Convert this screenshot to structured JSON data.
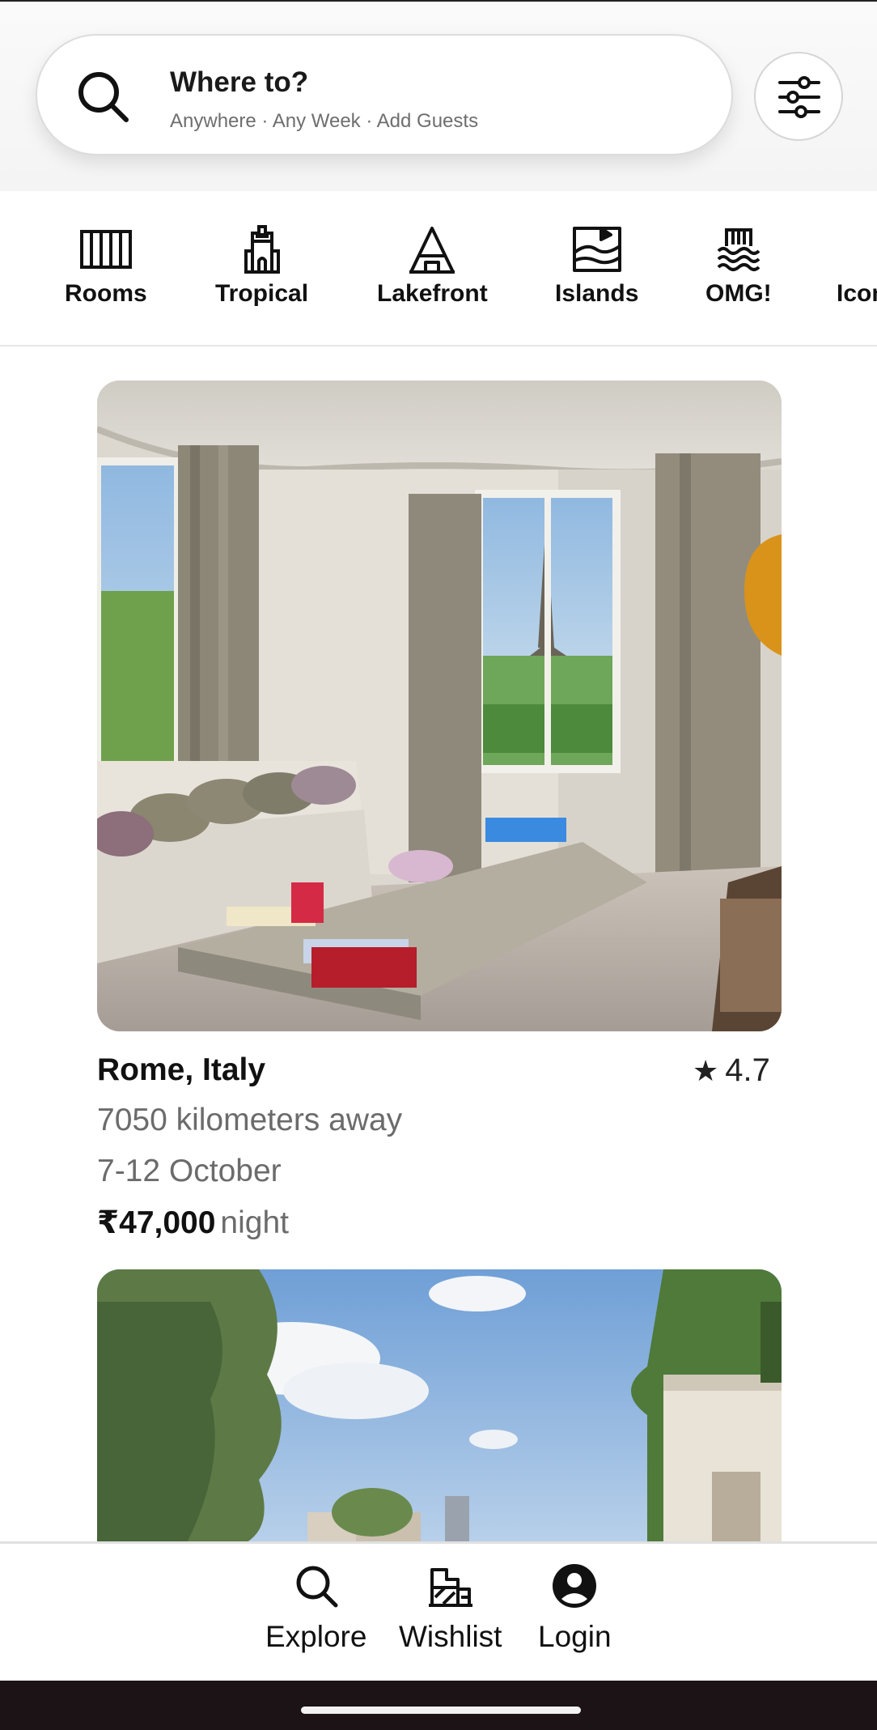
{
  "search": {
    "title": "Where to?",
    "subtitle": "Anywhere · Any Week · Add Guests",
    "icon": "search-icon"
  },
  "filter": {
    "icon": "sliders-icon"
  },
  "categories": [
    {
      "label": "Rooms",
      "icon": "rooms-icon"
    },
    {
      "label": "Tropical",
      "icon": "tower-icon"
    },
    {
      "label": "Lakefront",
      "icon": "a-frame-icon"
    },
    {
      "label": "Islands",
      "icon": "island-map-icon"
    },
    {
      "label": "OMG!",
      "icon": "waves-icon"
    },
    {
      "label": "Icons",
      "icon": "icons-icon"
    }
  ],
  "listing": {
    "title": "Rome, Italy",
    "rating_star": "★",
    "rating": "4.7",
    "distance": "7050 kilometers away",
    "dates": "7-12 October",
    "price": "₹47,000",
    "price_unit": "night"
  },
  "nav": [
    {
      "label": "Explore",
      "icon": "search-icon"
    },
    {
      "label": "Wishlist",
      "icon": "wishlist-icon"
    },
    {
      "label": "Login",
      "icon": "account-icon"
    }
  ],
  "colors": {
    "background": "#ffffff",
    "text": "#111111",
    "muted": "#6b6b6b",
    "system_bar": "#1b1316"
  }
}
